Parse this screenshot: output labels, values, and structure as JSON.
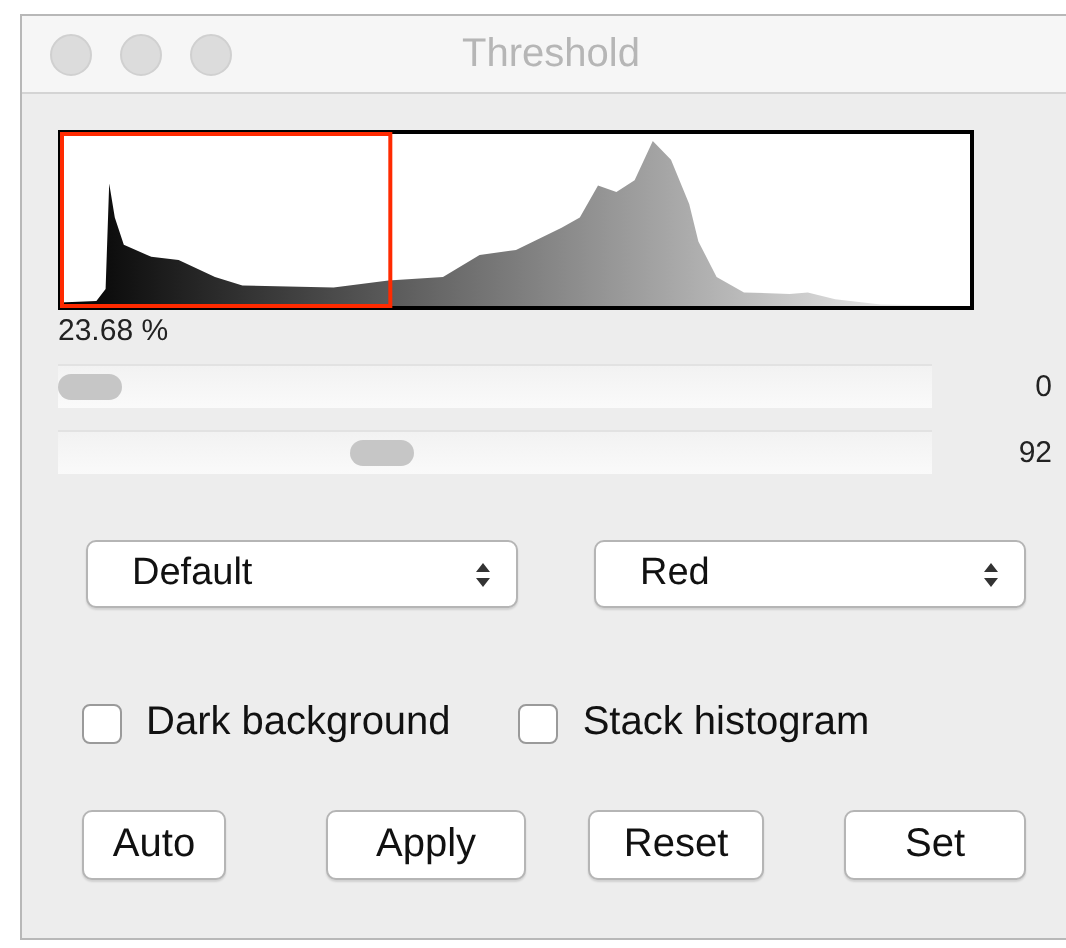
{
  "window": {
    "title": "Threshold"
  },
  "histogram": {
    "percent": "23.68 %"
  },
  "sliders": [
    {
      "level": 0,
      "reading": "0"
    },
    {
      "level": 0.36,
      "reading": "92"
    }
  ],
  "dropdowns": [
    {
      "value": "Default"
    },
    {
      "value": "Red"
    }
  ],
  "checkboxes": [
    {
      "label": "Dark background",
      "checked": false
    },
    {
      "label": "Stack histogram",
      "checked": false
    }
  ],
  "buttons": [
    "Auto",
    "Apply",
    "Reset",
    "Set"
  ]
}
